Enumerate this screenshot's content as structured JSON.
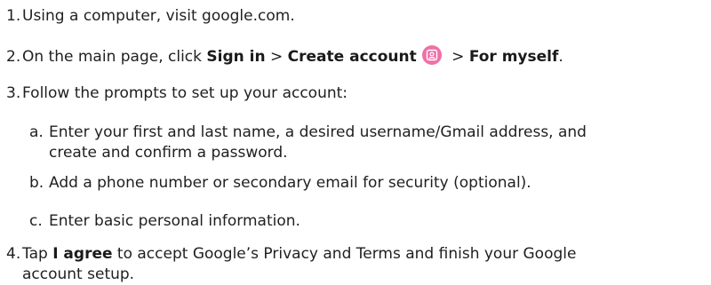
{
  "steps": [
    {
      "num": "1.",
      "text": "Using a computer, visit google.com."
    },
    {
      "num": "2.",
      "prefix": "On the main page, click ",
      "b1": "Sign in",
      "sep1": " > ",
      "b2": "Create account",
      "icon": "account-icon",
      "sep2": " > ",
      "b3": "For myself",
      "suffix": "."
    },
    {
      "num": "3.",
      "text": "Follow the prompts to set up your account:"
    },
    {
      "num": "4.",
      "prefix": "Tap ",
      "b1": "I agree",
      "line1_rest": " to accept Google’s Privacy and Terms and finish your Google",
      "line2": "account setup."
    }
  ],
  "substeps": [
    {
      "num": "a.",
      "line1": "Enter your first and last name, a desired username/Gmail address, and",
      "line2": "create and confirm a password."
    },
    {
      "num": "b.",
      "text": "Add a phone number or secondary email for security (optional)."
    },
    {
      "num": "c.",
      "text": "Enter basic personal information."
    }
  ],
  "colors": {
    "icon_bg": "#f06fa9",
    "text": "#1f1f1f"
  }
}
